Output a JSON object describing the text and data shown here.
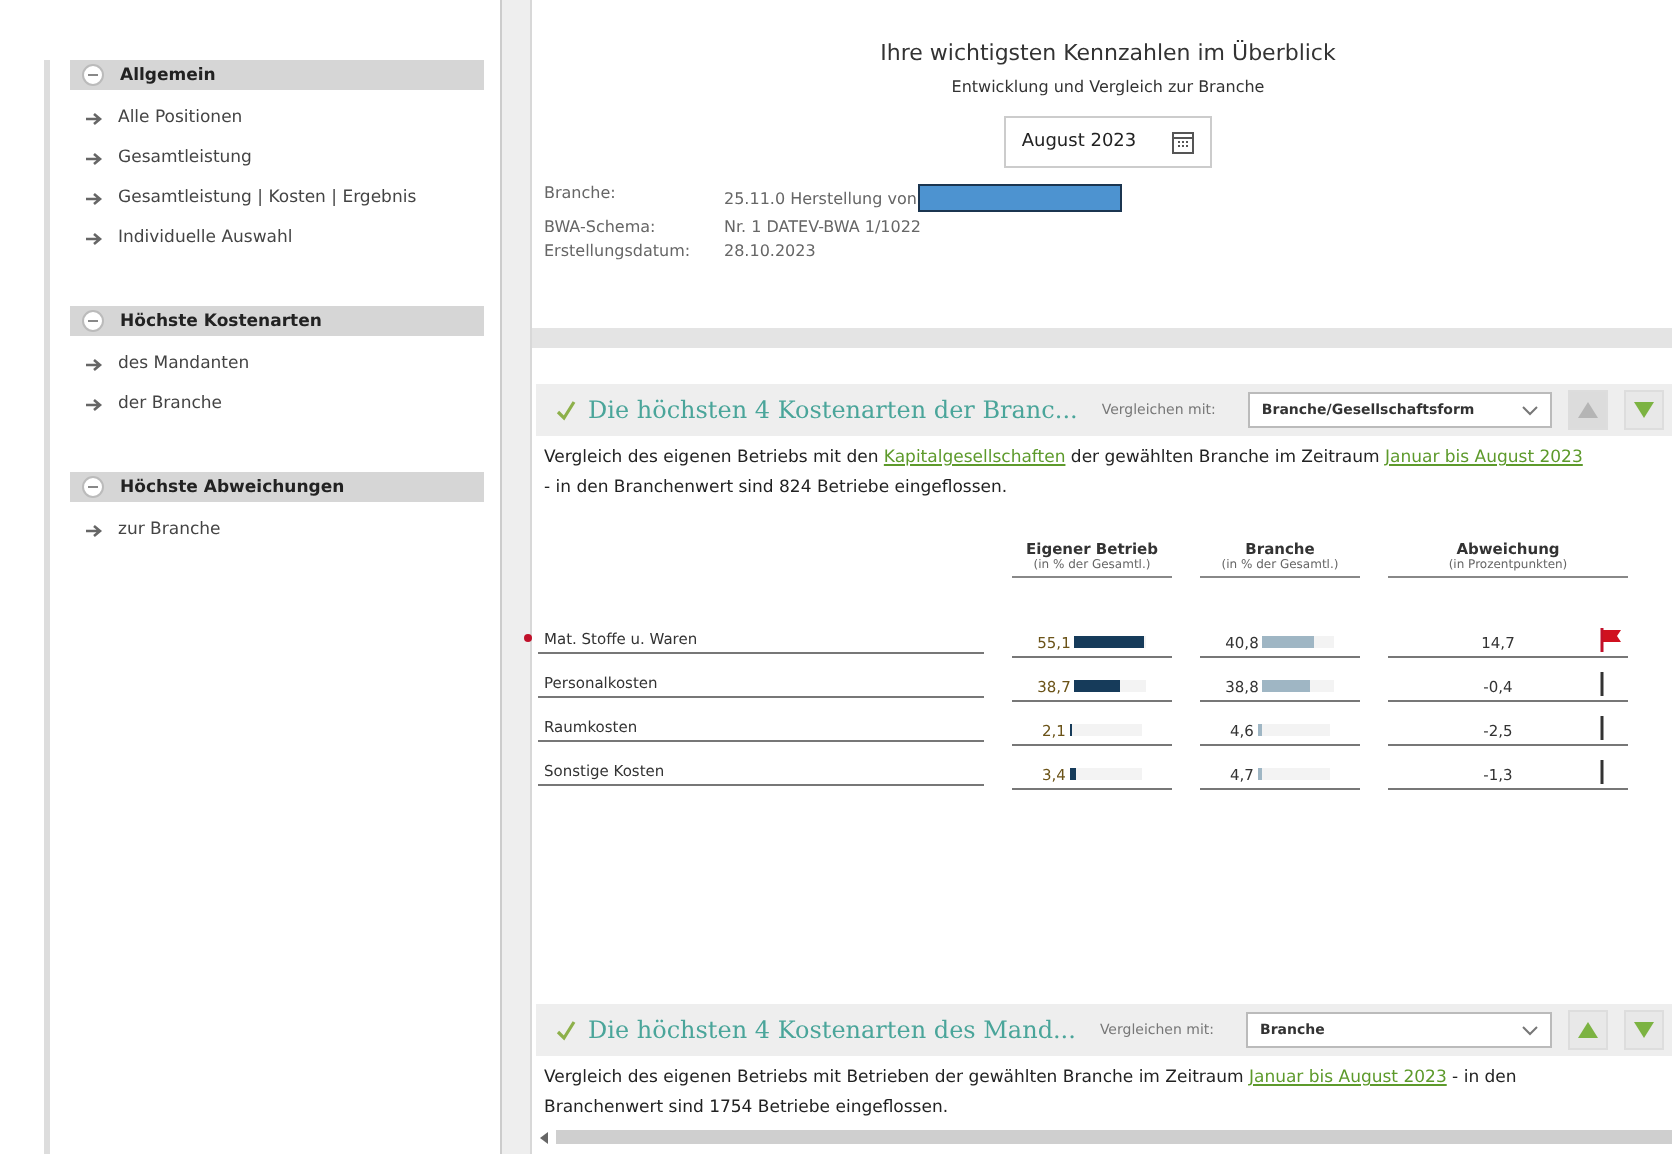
{
  "sidebar": {
    "groups": [
      {
        "title": "Allgemein",
        "expanded": true,
        "items": [
          "Alle Positionen",
          "Gesamtleistung",
          "Gesamtleistung | Kosten | Ergebnis",
          "Individuelle Auswahl"
        ]
      },
      {
        "title": "Höchste Kostenarten",
        "expanded": true,
        "items": [
          "des Mandanten",
          "der Branche"
        ]
      },
      {
        "title": "Höchste Abweichungen",
        "expanded": true,
        "items": [
          "zur Branche"
        ]
      }
    ]
  },
  "header": {
    "title": "Ihre wichtigsten Kennzahlen im Überblick",
    "subtitle": "Entwicklung und Vergleich zur Branche",
    "period": "August 2023",
    "info": [
      {
        "label": "Branche:",
        "value": "25.11.0 Herstellung von",
        "redacted": true
      },
      {
        "label": "BWA-Schema:",
        "value": "Nr. 1 DATEV-BWA 1/1022",
        "redacted": false
      },
      {
        "label": "Erstellungsdatum:",
        "value": "28.10.2023",
        "redacted": false
      }
    ]
  },
  "sections": [
    {
      "title": "Die höchsten 4 Kostenarten der Branc...",
      "compare_label": "Vergleichen mit:",
      "compare_value": "Branche/Gesellschaftsform",
      "up_disabled": true,
      "down_disabled": false,
      "text": [
        {
          "kind": "plain",
          "text": "Vergleich des eigenen Betriebs mit den "
        },
        {
          "kind": "link",
          "text": "Kapitalgesellschaften"
        },
        {
          "kind": "plain",
          "text": " der gewählten Branche im Zeitraum "
        },
        {
          "kind": "link",
          "text": "Januar bis August 2023"
        },
        {
          "kind": "plain",
          "text": " - in den Branchenwert sind 824 Betriebe eingeflossen."
        }
      ],
      "table": {
        "columns": [
          {
            "title": "Eigener Betrieb",
            "sub": "(in % der Gesamtl.)"
          },
          {
            "title": "Branche",
            "sub": "(in % der Gesamtl.)"
          },
          {
            "title": "Abweichung",
            "sub": "(in Prozentpunkten)"
          }
        ],
        "rows": [
          {
            "name": "Mat. Stoffe u. Waren",
            "marked": true,
            "own": "55,1",
            "own_bar": {
              "level": 0.95
            },
            "branch": "40,8",
            "branch_bar": {
              "level": 0.7
            },
            "deviation": "14,7",
            "flagged": true
          },
          {
            "name": "Personalkosten",
            "marked": false,
            "own": "38,7",
            "own_bar": {
              "level": 0.62
            },
            "branch": "38,8",
            "branch_bar": {
              "level": 0.66
            },
            "deviation": "-0,4",
            "flagged": false
          },
          {
            "name": "Raumkosten",
            "marked": false,
            "own": "2,1",
            "own_bar": {
              "level": 0.04
            },
            "branch": "4,6",
            "branch_bar": {
              "level": 0.06
            },
            "deviation": "-2,5",
            "flagged": false
          },
          {
            "name": "Sonstige Kosten",
            "marked": false,
            "own": "3,4",
            "own_bar": {
              "level": 0.08
            },
            "branch": "4,7",
            "branch_bar": {
              "level": 0.06
            },
            "deviation": "-1,3",
            "flagged": false
          }
        ]
      }
    },
    {
      "title": "Die höchsten 4 Kostenarten des Mand...",
      "compare_label": "Vergleichen mit:",
      "compare_value": "Branche",
      "up_disabled": false,
      "down_disabled": false,
      "text": [
        {
          "kind": "plain",
          "text": "Vergleich des eigenen Betriebs mit Betrieben der gewählten Branche im Zeitraum "
        },
        {
          "kind": "link",
          "text": "Januar bis August 2023"
        },
        {
          "kind": "plain",
          "text": " - in den Branchenwert sind 1754 Betriebe eingeflossen."
        }
      ]
    }
  ]
}
